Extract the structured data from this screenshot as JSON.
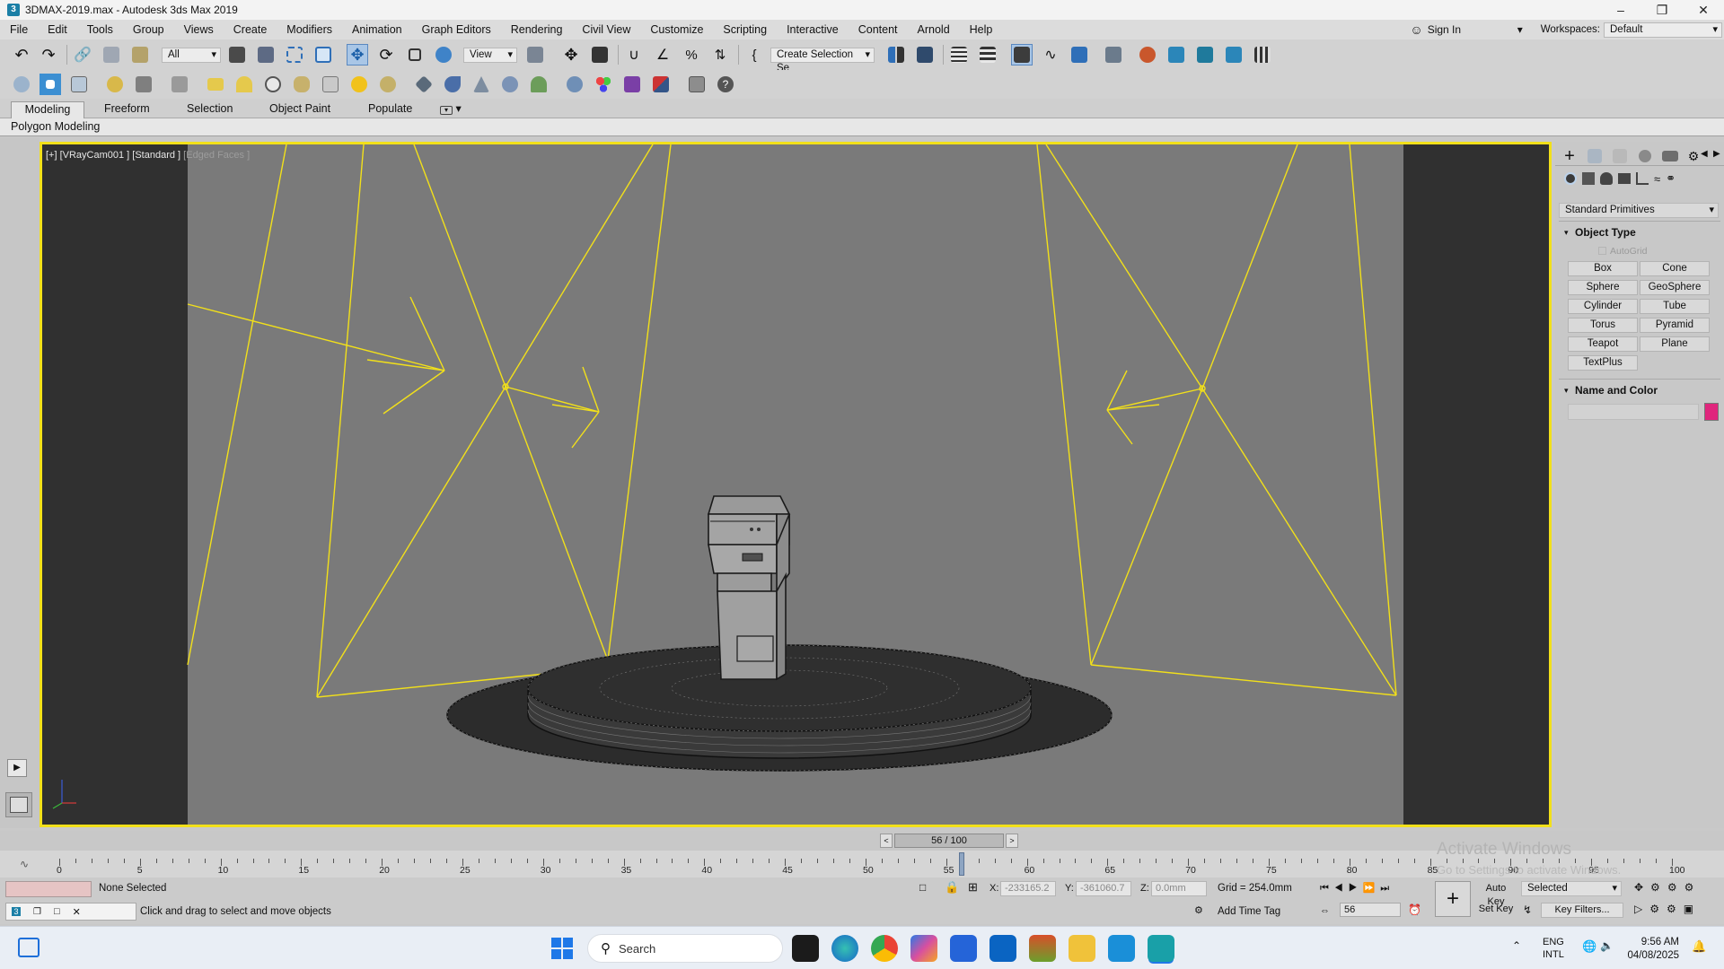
{
  "window": {
    "title": "3DMAX-2019.max - Autodesk 3ds Max 2019",
    "app_icon": "3"
  },
  "menu": {
    "items": [
      "File",
      "Edit",
      "Tools",
      "Group",
      "Views",
      "Create",
      "Modifiers",
      "Animation",
      "Graph Editors",
      "Rendering",
      "Civil View",
      "Customize",
      "Scripting",
      "Interactive",
      "Content",
      "Arnold",
      "Help"
    ],
    "sign_in": "Sign In",
    "workspaces_label": "Workspaces:",
    "workspace_value": "Default"
  },
  "toolbar": {
    "selection_filter": "All",
    "ref_coord": "View",
    "named_selection": "Create Selection Se"
  },
  "ribbon": {
    "tabs": [
      "Modeling",
      "Freeform",
      "Selection",
      "Object Paint",
      "Populate"
    ],
    "panel_label": "Polygon Modeling"
  },
  "viewport": {
    "label_main": "[+] [VRayCam001 ] [Standard ]",
    "label_mode": "[Edged Faces ]",
    "colors": {
      "border": "#f2e01a",
      "light": "#f2e01a",
      "bg": "#7a7a7a",
      "safe_frame": "#303030"
    }
  },
  "command_panel": {
    "category": "Standard Primitives",
    "object_type_title": "Object Type",
    "autogrid": "AutoGrid",
    "buttons": [
      "Box",
      "Cone",
      "Sphere",
      "GeoSphere",
      "Cylinder",
      "Tube",
      "Torus",
      "Pyramid",
      "Teapot",
      "Plane",
      "TextPlus"
    ],
    "name_color_title": "Name and Color",
    "swatch_color": "#e0267d"
  },
  "time_slider": {
    "frame_label": "56 / 100",
    "current_frame": 56,
    "total_frames": 100
  },
  "timeline": {
    "ticks": [
      "0",
      "5",
      "10",
      "15",
      "20",
      "25",
      "30",
      "35",
      "40",
      "45",
      "50",
      "55",
      "60",
      "65",
      "70",
      "75",
      "80",
      "85",
      "90",
      "95",
      "100"
    ],
    "watermark": "Activate Windows",
    "watermark_sub": "Go to Settings to activate Windows."
  },
  "status": {
    "selection": "None Selected",
    "prompt": "Click and drag to select and move objects",
    "x_label": "X:",
    "x_value": "-233165.2",
    "y_label": "Y:",
    "y_value": "-361060.7",
    "z_label": "Z:",
    "z_value": "0.0mm",
    "grid": "Grid = 254.0mm",
    "add_time_tag": "Add Time Tag",
    "auto_key": "Auto Key",
    "selected": "Selected",
    "set_key": "Set Key",
    "key_filters": "Key Filters...",
    "frame_field": "56"
  },
  "taskbar": {
    "search_placeholder": "Search",
    "lang": "ENG",
    "lang_sub": "INTL",
    "time": "9:56 AM",
    "date": "04/08/2025"
  }
}
